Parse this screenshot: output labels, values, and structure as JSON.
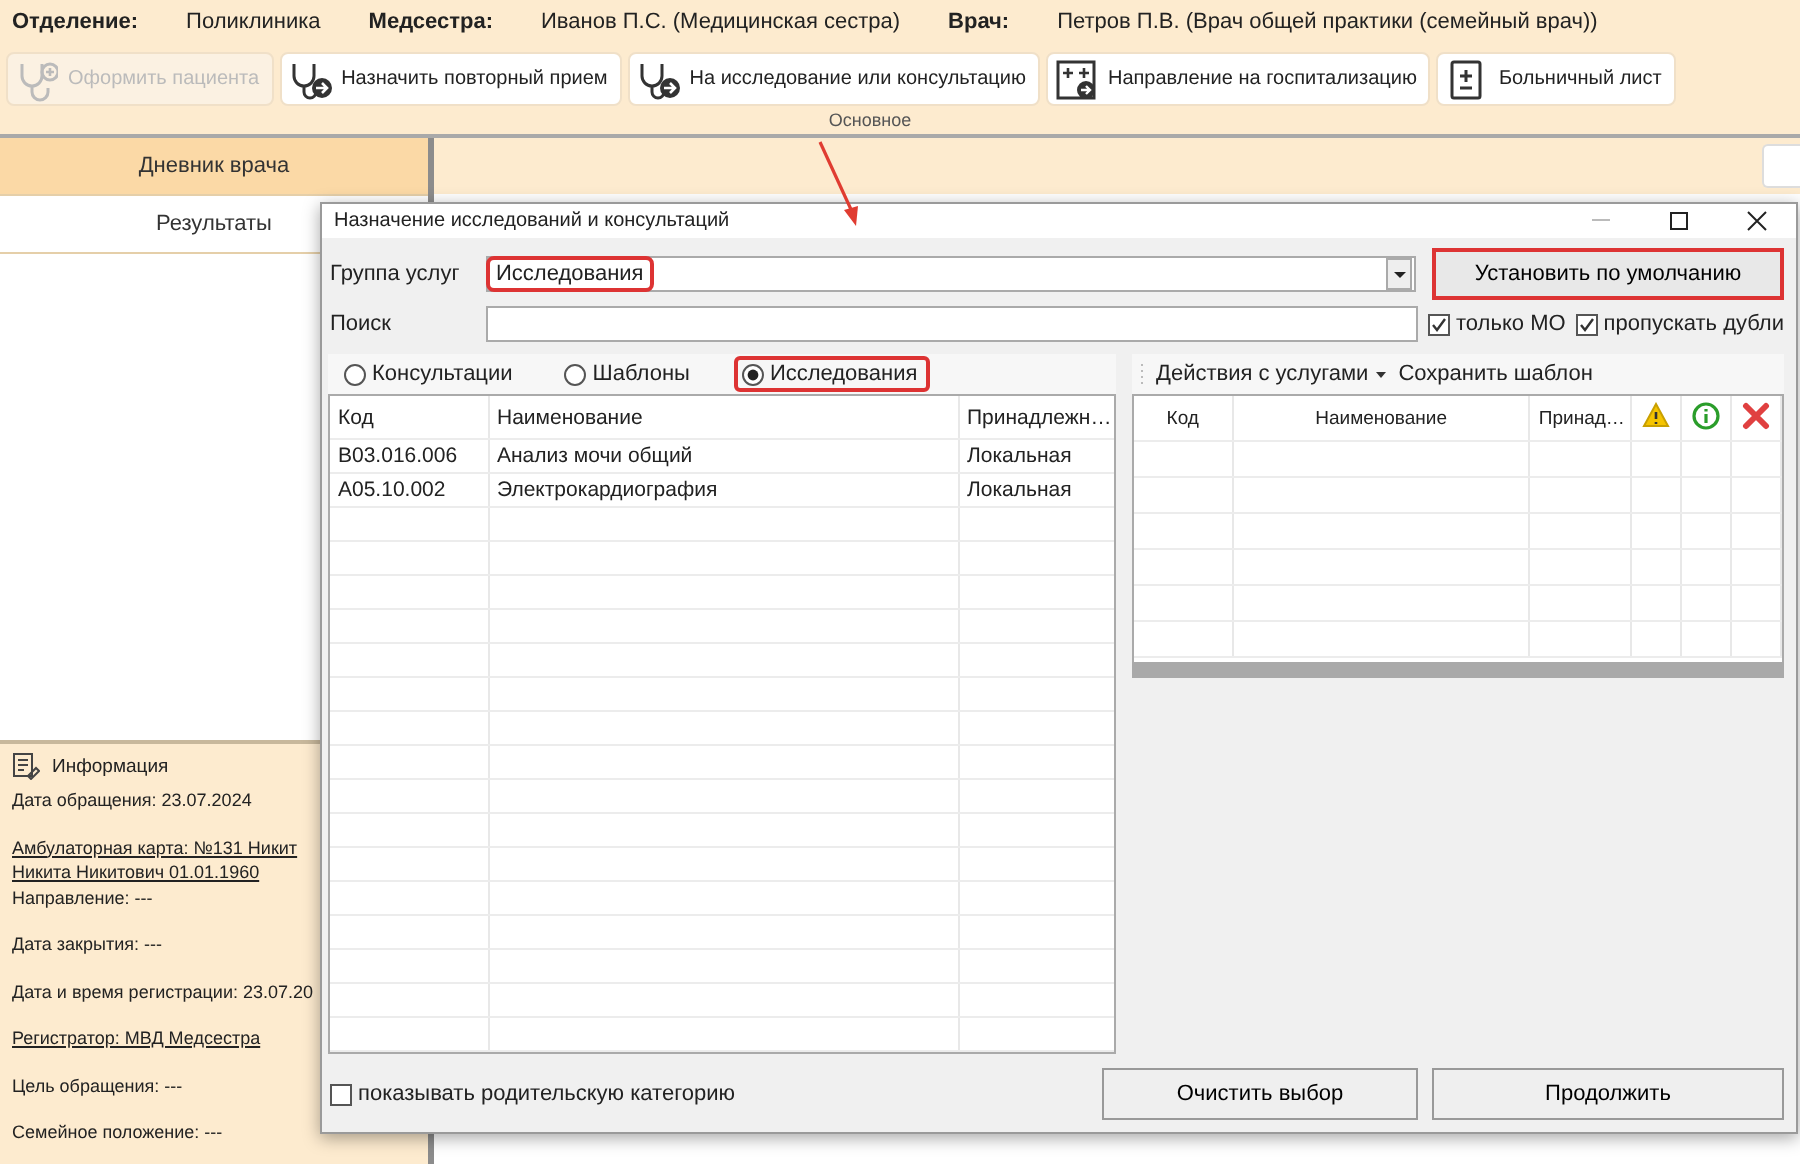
{
  "header": {
    "fields": [
      {
        "label": "Отделение:",
        "value": "Поликлиника"
      },
      {
        "label": "Медсестра:",
        "value": "Иванов П.С. (Медицинская сестра)"
      },
      {
        "label": "Врач:",
        "value": "Петров П.В. (Врач общей практики (семейный врач))"
      }
    ]
  },
  "toolbar": {
    "buttons": [
      {
        "label": "Оформить пациента",
        "disabled": true
      },
      {
        "label": "Назначить повторный прием",
        "disabled": false
      },
      {
        "label": "На исследование или консультацию",
        "disabled": false
      },
      {
        "label": "Направление на госпитализацию",
        "disabled": false
      },
      {
        "label": "Больничный лист",
        "disabled": false
      }
    ],
    "group_label": "Основное"
  },
  "sidebar": {
    "tabs": [
      {
        "label": "Дневник врача",
        "selected": true
      },
      {
        "label": "Результаты",
        "selected": false
      }
    ]
  },
  "info_panel": {
    "title": "Информация",
    "paragraphs": [
      [
        {
          "text": "Дата обращения: 23.07.2024",
          "link": false
        }
      ],
      [
        {
          "text": "Амбулаторная карта: №131 Никит",
          "link": true
        },
        {
          "text": "Никита Никитович 01.01.1960",
          "link": true
        },
        {
          "text": "Направление: ---",
          "link": false
        }
      ],
      [
        {
          "text": "Дата закрытия: ---",
          "link": false
        }
      ],
      [
        {
          "text": "Дата и время регистрации: 23.07.20",
          "link": false
        }
      ],
      [
        {
          "text": "Регистратор: МВД Медсестра",
          "link": true
        }
      ],
      [
        {
          "text": "Цель обращения: ---",
          "link": false
        }
      ],
      [
        {
          "text": "Семейное положение: ---",
          "link": false
        }
      ]
    ]
  },
  "dialog": {
    "title": "Назначение исследований и консультаций",
    "service_group": {
      "label": "Группа услуг",
      "value": "Исследования",
      "highlighted": true
    },
    "default_button": {
      "label": "Установить по умолчанию",
      "highlighted": true
    },
    "search": {
      "label": "Поиск"
    },
    "options": [
      {
        "label": "только МО",
        "checked": true
      },
      {
        "label": "пропускать дубли",
        "checked": true
      }
    ],
    "radios": [
      {
        "label": "Консультации",
        "selected": false,
        "highlighted": false
      },
      {
        "label": "Шаблоны",
        "selected": false,
        "highlighted": false
      },
      {
        "label": "Исследования",
        "selected": true,
        "highlighted": true
      }
    ],
    "services_table": {
      "columns": [
        "Код",
        "Наименование",
        "Принадлежн…"
      ],
      "rows": [
        [
          "B03.016.006",
          "Анализ мочи общий",
          "Локальная"
        ],
        [
          "A05.10.002",
          "Электрокардиография",
          "Локальная"
        ]
      ]
    },
    "actions_menu": "Действия с услугами",
    "save_template": "Сохранить шаблон",
    "selected_table": {
      "columns": [
        {
          "kind": "text",
          "label": "Код"
        },
        {
          "kind": "text",
          "label": "Наименование"
        },
        {
          "kind": "text",
          "label": "Принад…"
        },
        {
          "kind": "warning"
        },
        {
          "kind": "info"
        },
        {
          "kind": "delete"
        }
      ]
    },
    "parent_category": {
      "label": "показывать родительскую категорию",
      "checked": false
    },
    "buttons": [
      "Очистить выбор",
      "Продолжить"
    ]
  }
}
